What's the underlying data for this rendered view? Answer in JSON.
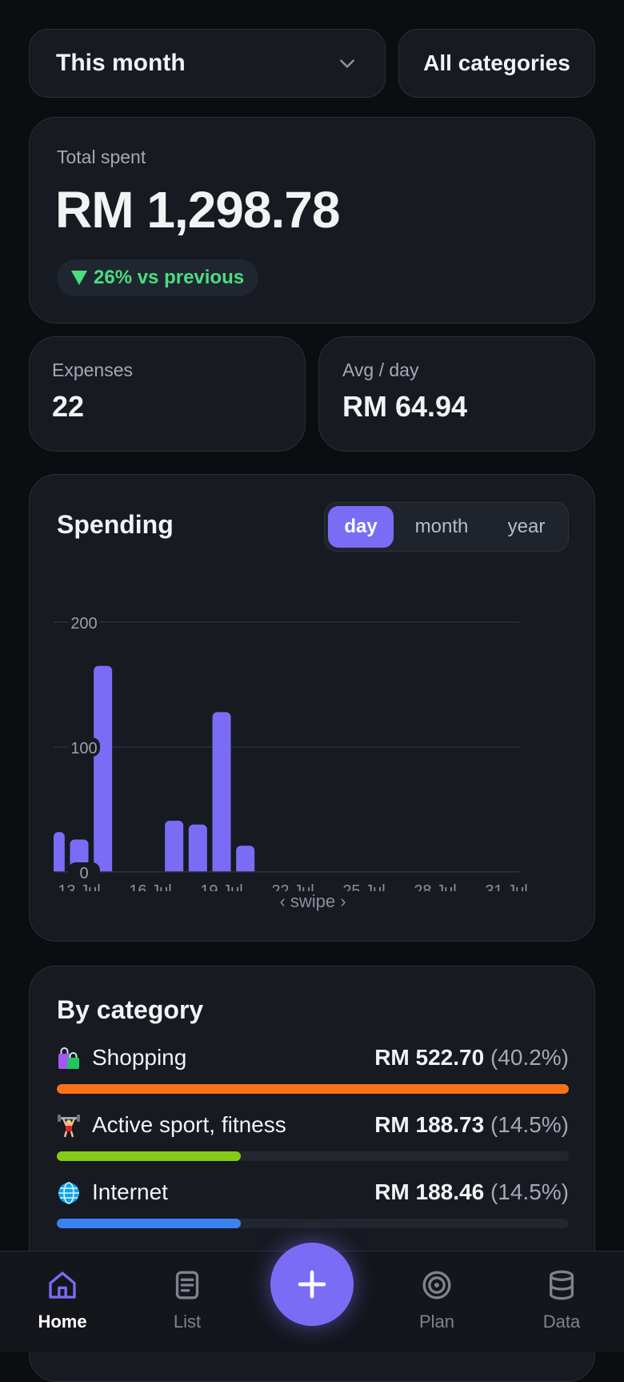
{
  "filters": {
    "period": "This month",
    "category": "All categories"
  },
  "summary": {
    "total_label": "Total spent",
    "total_value": "RM 1,298.78",
    "change_text": "26% vs previous",
    "change_color": "#4ade80"
  },
  "stats": {
    "expenses_label": "Expenses",
    "expenses_value": "22",
    "avg_label": "Avg / day",
    "avg_value": "RM 64.94"
  },
  "spending": {
    "title": "Spending",
    "tabs": [
      "day",
      "month",
      "year"
    ],
    "active_tab": "day",
    "swipe_hint": "‹ swipe ›"
  },
  "chart_data": {
    "type": "bar",
    "title": "",
    "xlabel": "",
    "ylabel": "",
    "ylim": [
      0,
      200
    ],
    "yticks": [
      0,
      100,
      200
    ],
    "x_tick_labels": [
      "13 Jul",
      "16 Jul",
      "19 Jul",
      "22 Jul",
      "25 Jul",
      "28 Jul",
      "31 Jul"
    ],
    "x_tick_days": [
      13,
      16,
      19,
      22,
      25,
      28,
      31
    ],
    "x_range": [
      12.7,
      31
    ],
    "categories": [
      "12 Jul",
      "13 Jul",
      "14 Jul",
      "15 Jul",
      "16 Jul",
      "17 Jul",
      "18 Jul",
      "19 Jul",
      "20 Jul"
    ],
    "days": [
      12,
      13,
      14,
      15,
      16,
      17,
      18,
      19,
      20
    ],
    "values": [
      32,
      26,
      165,
      0,
      0,
      41,
      38,
      128,
      21
    ],
    "bar_color": "#7b6cf6",
    "grid": true
  },
  "by_category": {
    "title": "By category",
    "items": [
      {
        "name": "Shopping",
        "amount": "RM 522.70",
        "percent": "(40.2%)",
        "fraction": 1.0,
        "color": "#f97316",
        "icon": "shopping-bags-icon"
      },
      {
        "name": "Active sport, fitness",
        "amount": "RM 188.73",
        "percent": "(14.5%)",
        "fraction": 0.36,
        "color": "#84cc16",
        "icon": "weightlifter-icon"
      },
      {
        "name": "Internet",
        "amount": "RM 188.46",
        "percent": "(14.5%)",
        "fraction": 0.36,
        "color": "#3b82f6",
        "icon": "globe-icon"
      }
    ]
  },
  "nav": {
    "home": "Home",
    "list": "List",
    "plan": "Plan",
    "data": "Data",
    "accent": "#7b6cf6"
  }
}
